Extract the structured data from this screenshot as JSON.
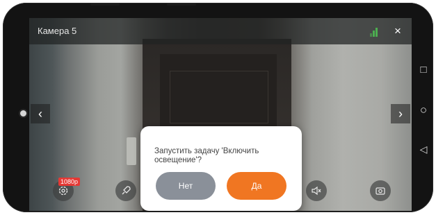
{
  "header": {
    "camera_name": "Камера 5",
    "close_symbol": "×"
  },
  "nav": {
    "prev_symbol": "‹",
    "next_symbol": "›"
  },
  "quality_badge": "1080p",
  "dialog": {
    "message": "Запустить задачу 'Включить освещение'?",
    "no_label": "Нет",
    "yes_label": "Да"
  },
  "system_nav": {
    "recents_symbol": "□",
    "home_symbol": "○",
    "back_symbol": "◁"
  },
  "colors": {
    "accent": "#f07622",
    "secondary_button": "#8a9099",
    "signal": "#4caf50",
    "badge": "#e53935"
  },
  "icons": [
    "settings-icon",
    "rocket-icon",
    "mute-icon",
    "screenshot-icon",
    "signal-icon",
    "close-icon"
  ]
}
